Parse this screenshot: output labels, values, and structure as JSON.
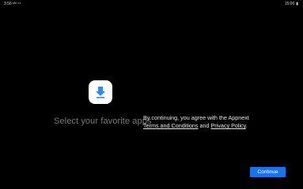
{
  "status_bar": {
    "time": "3:56",
    "left_extra": "ᵖᴹ ⁴⁴",
    "right_text": "15:00"
  },
  "hero": {
    "icon": "download-arrow-icon",
    "headline": "Select your favorite apps"
  },
  "consent": {
    "prefix": "By continuing, you agree with the Appnext",
    "terms_link": "Terms and Conditions",
    "and_text": "and",
    "privacy_link": "Privacy Policy",
    "suffix": "."
  },
  "actions": {
    "continue_label": "Continue"
  },
  "colors": {
    "background": "#000000",
    "accent": "#1a73e8",
    "icon_blue": "#2d8cf0",
    "muted_text": "#7a7a7a"
  }
}
